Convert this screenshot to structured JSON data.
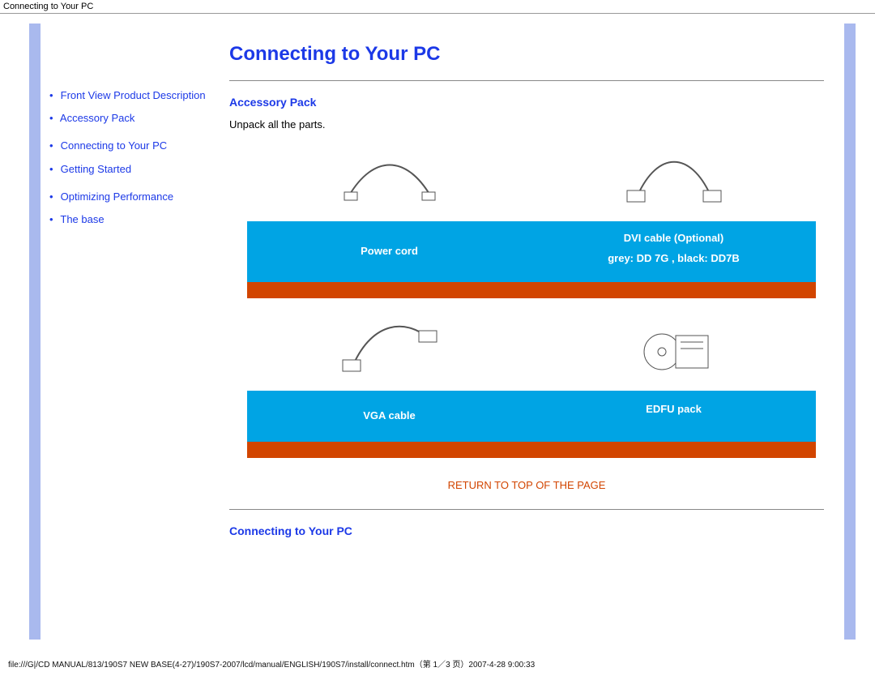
{
  "header_path": "Connecting to Your PC",
  "footer_path": "file:///G|/CD MANUAL/813/190S7 NEW BASE(4-27)/190S7-2007/lcd/manual/ENGLISH/190S7/install/connect.htm（第 1／3 页）2007-4-28 9:00:33",
  "nav": {
    "items": [
      "Front View Product Description",
      "Accessory Pack",
      "Connecting to Your PC",
      "Getting Started",
      "Optimizing Performance",
      "The base"
    ]
  },
  "title": "Connecting to Your PC",
  "sections": {
    "accessory": {
      "heading": "Accessory Pack",
      "intro": "Unpack all the parts.",
      "items": [
        {
          "caption": "Power cord"
        },
        {
          "caption_line1": "DVI cable (Optional)",
          "caption_line2": "grey: DD 7G , black: DD7B"
        },
        {
          "caption": "VGA cable"
        },
        {
          "caption": "EDFU pack"
        }
      ],
      "return_link": "RETURN TO TOP OF THE PAGE"
    },
    "connecting": {
      "heading": "Connecting to Your PC"
    }
  }
}
